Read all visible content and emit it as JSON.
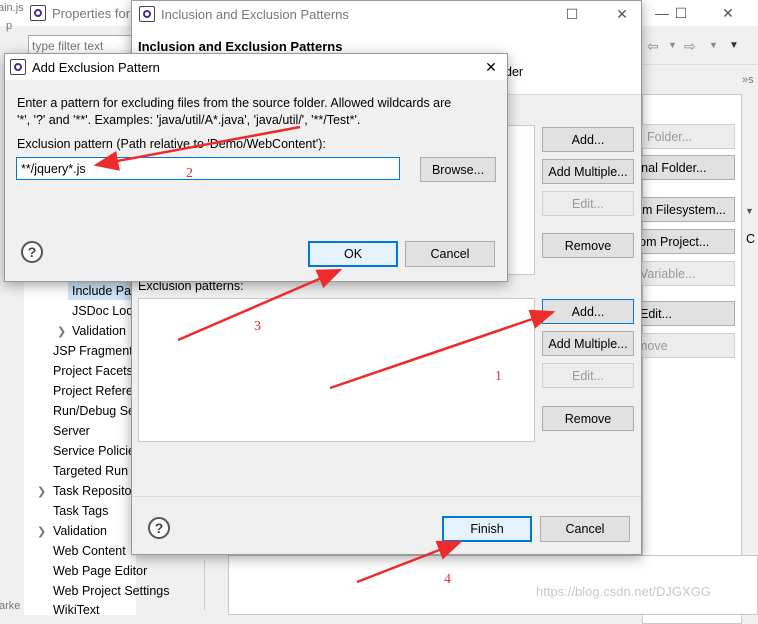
{
  "background": {
    "properties_title": "Properties for",
    "filter_placeholder": "type filter text",
    "tree_items": [
      "Include Pa",
      "JSDoc Loc",
      "Validation",
      "JSP Fragment",
      "Project Facets",
      "Project Refere",
      "Run/Debug Se",
      "Server",
      "Service Policie",
      "Targeted Run",
      "Task Reposito",
      "Task Tags",
      "Validation",
      "Web Content",
      "Web Page Editor",
      "Web Project Settings",
      "WikiText"
    ],
    "right_buttons": [
      "Folder...",
      "rnal Folder...",
      "om Filesystem...",
      "rom Project...",
      "Variable...",
      "Edit...",
      "move"
    ],
    "left_edge_texts": [
      "ain.js",
      "p",
      "arke"
    ],
    "right_edge_text": "C"
  },
  "inclusion_dialog": {
    "title": "Inclusion and Exclusion Patterns",
    "heading": "Inclusion and Exclusion Patterns",
    "sub_text": "der",
    "inclusion_buttons": {
      "add": "Add...",
      "add_multiple": "Add Multiple...",
      "edit": "Edit...",
      "remove": "Remove"
    },
    "exclusion_label": "Exclusion patterns:",
    "exclusion_buttons": {
      "add": "Add...",
      "add_multiple": "Add Multiple...",
      "edit": "Edit...",
      "remove": "Remove"
    },
    "finish": "Finish",
    "cancel": "Cancel"
  },
  "add_dialog": {
    "title": "Add Exclusion Pattern",
    "description_line1": "Enter a pattern for excluding files from the source folder. Allowed wildcards are",
    "description_line2": "'*', '?' and '**'. Examples: 'java/util/A*.java', 'java/util/', '**/Test*'.",
    "pattern_label": "Exclusion pattern (Path relative to 'Demo/WebContent'):",
    "pattern_value": "**/jquery*.js",
    "browse": "Browse...",
    "ok": "OK",
    "cancel": "Cancel"
  },
  "annotations": [
    "1",
    "2",
    "3",
    "4"
  ],
  "watermark": "https://blog.csdn.net/DJGXGG",
  "colors": {
    "arrow": "#ec2b2b",
    "accent": "#0078d7"
  }
}
